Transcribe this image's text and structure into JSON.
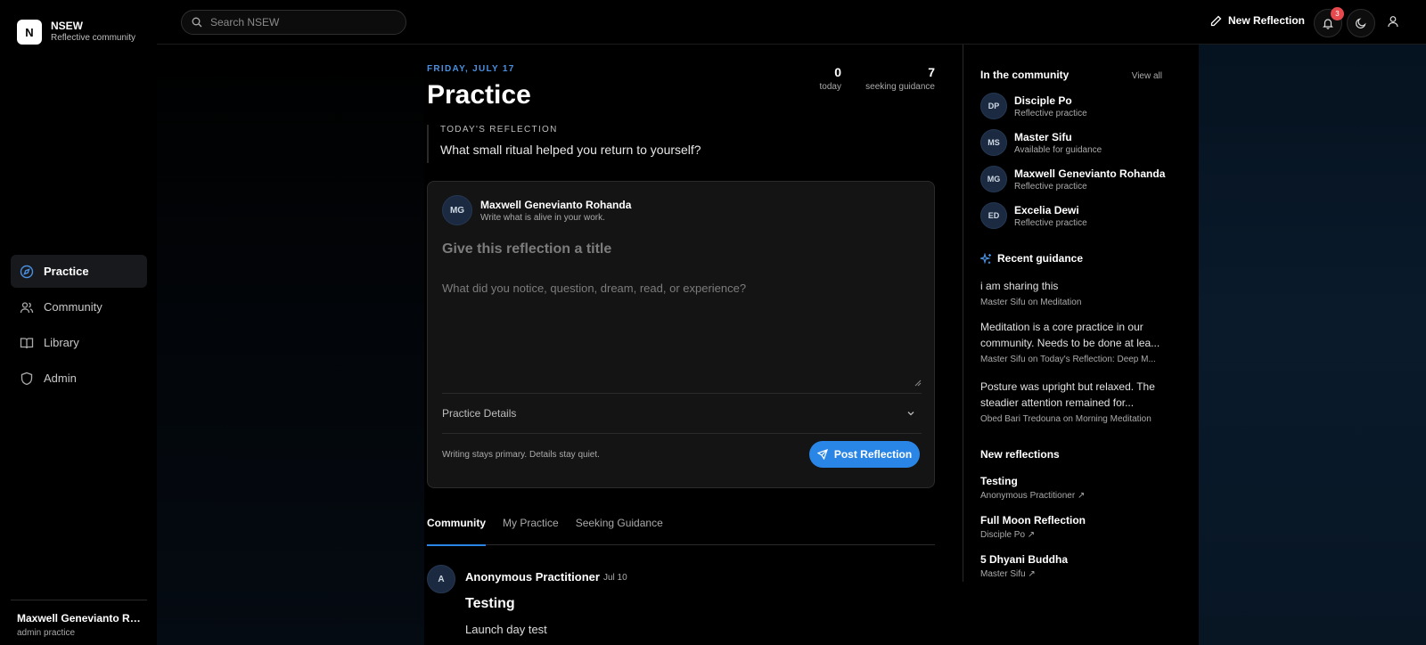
{
  "brand": {
    "logo": "N",
    "name": "NSEW",
    "subtitle": "Reflective community"
  },
  "sidebar": {
    "items": [
      {
        "label": "Practice",
        "icon": "compass-icon"
      },
      {
        "label": "Community",
        "icon": "users-icon"
      },
      {
        "label": "Library",
        "icon": "book-icon"
      },
      {
        "label": "Admin",
        "icon": "shield-icon"
      }
    ],
    "user": {
      "name": "Maxwell Genevianto Ro...",
      "role": "admin practice"
    }
  },
  "topbar": {
    "search_placeholder": "Search NSEW",
    "new_reflection": "New Reflection",
    "notification_count": "3"
  },
  "main": {
    "date": "FRIDAY, JULY 17",
    "title": "Practice",
    "stats": [
      {
        "value": "0",
        "label": "today"
      },
      {
        "value": "7",
        "label": "seeking guidance"
      }
    ],
    "prompt_label": "TODAY'S REFLECTION",
    "prompt_question": "What small ritual helped you return to yourself?",
    "composer": {
      "avatar": "MG",
      "name": "Maxwell Genevianto Rohanda",
      "subtitle": "Write what is alive in your work.",
      "title_placeholder": "Give this reflection a title",
      "body_placeholder": "What did you notice, question, dream, read, or experience?",
      "details_label": "Practice Details",
      "footer_note": "Writing stays primary. Details stay quiet.",
      "post_label": "Post Reflection"
    },
    "tabs": [
      "Community",
      "My Practice",
      "Seeking Guidance"
    ],
    "post": {
      "avatar": "A",
      "author": "Anonymous Practitioner",
      "date": "Jul 10",
      "title": "Testing",
      "text": "Launch day test"
    }
  },
  "rail": {
    "community_title": "In the community",
    "view_all": "View all",
    "members": [
      {
        "initials": "DP",
        "name": "Disciple Po",
        "role": "Reflective practice"
      },
      {
        "initials": "MS",
        "name": "Master Sifu",
        "role": "Available for guidance"
      },
      {
        "initials": "MG",
        "name": "Maxwell Genevianto Rohanda",
        "role": "Reflective practice"
      },
      {
        "initials": "ED",
        "name": "Excelia Dewi",
        "role": "Reflective practice"
      }
    ],
    "guidance_title": "Recent guidance",
    "guidance": [
      {
        "text": "i am sharing this",
        "meta": "Master Sifu on Meditation"
      },
      {
        "text": "Meditation is a core practice in our community. Needs to be done at lea...",
        "meta": "Master Sifu on Today's Reflection: Deep M..."
      },
      {
        "text": "Posture was upright but relaxed. The steadier attention remained for...",
        "meta": "Obed Bari Tredouna on Morning Meditation"
      }
    ],
    "new_title": "New reflections",
    "new_reflections": [
      {
        "title": "Testing",
        "author": "Anonymous Practitioner ↗"
      },
      {
        "title": "Full Moon Reflection",
        "author": "Disciple Po ↗"
      },
      {
        "title": "5 Dhyani Buddha",
        "author": "Master Sifu ↗"
      }
    ]
  },
  "colors": {
    "accent": "#2a86e6",
    "badge": "#e5484d",
    "date": "#4a8fe0"
  }
}
